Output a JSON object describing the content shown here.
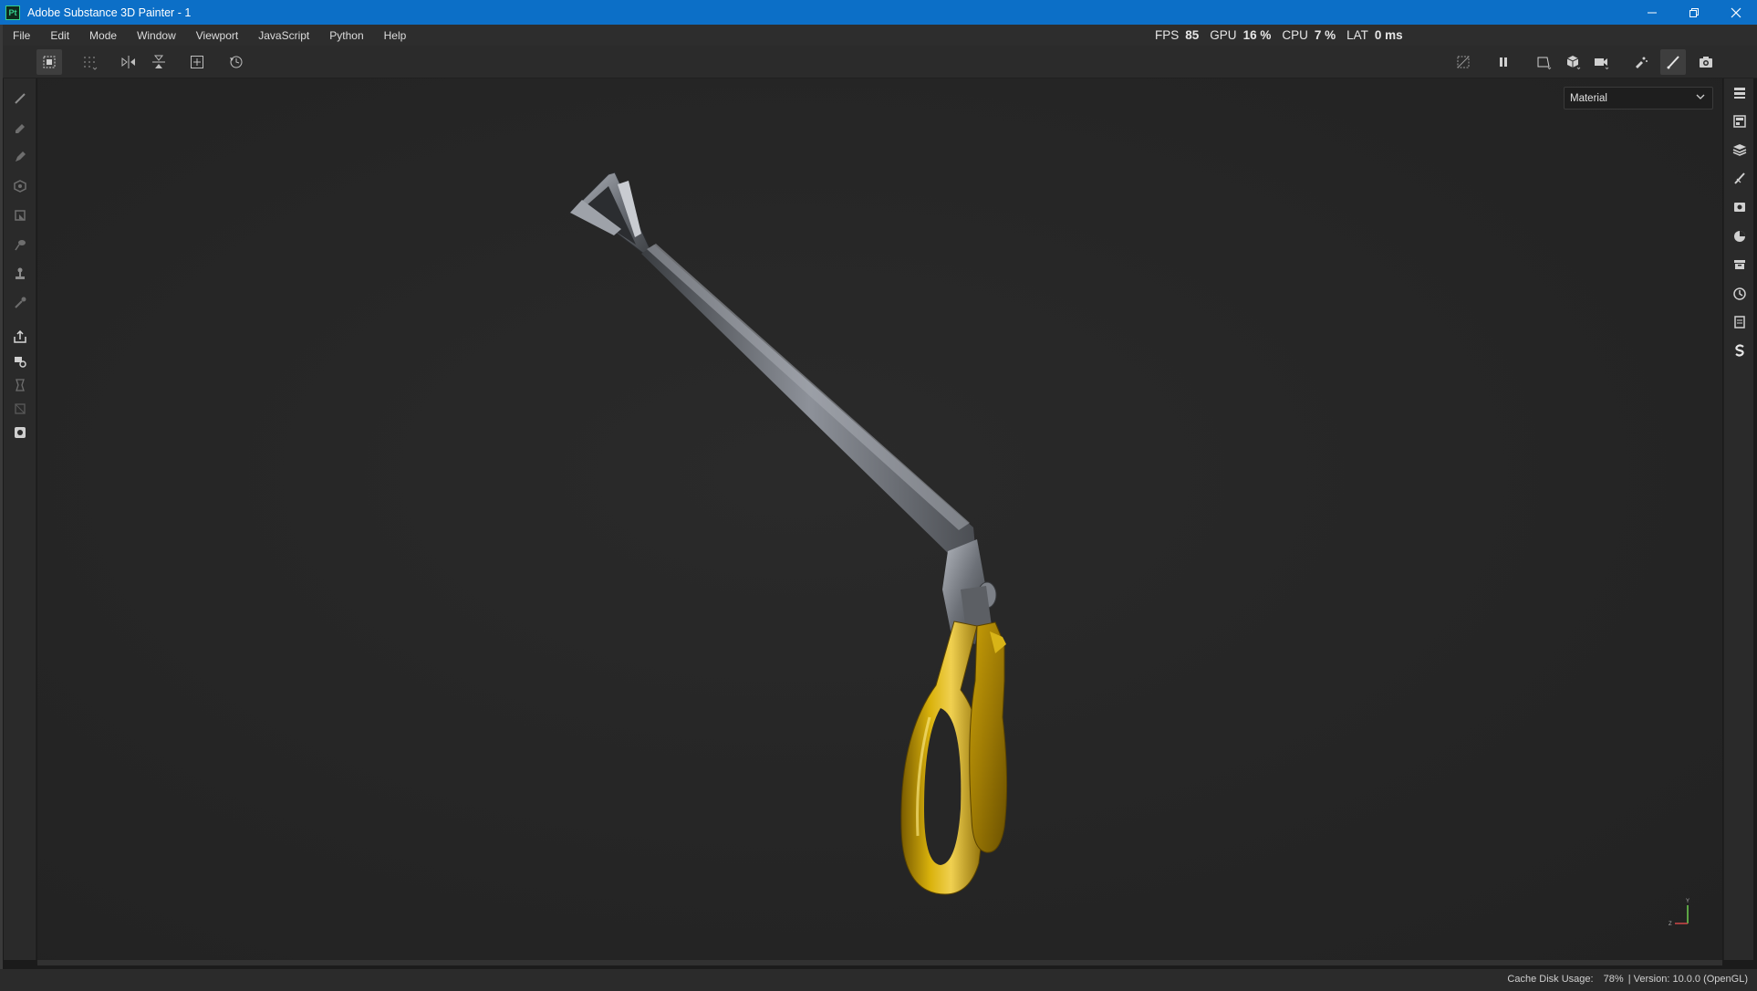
{
  "window": {
    "title": "Adobe Substance 3D Painter - 1",
    "app_icon_text": "Pt",
    "controls": [
      "minimize-icon",
      "restore-icon",
      "close-icon"
    ]
  },
  "menu": {
    "items": [
      "File",
      "Edit",
      "Mode",
      "Window",
      "Viewport",
      "JavaScript",
      "Python",
      "Help"
    ]
  },
  "stats": {
    "fps_label": "FPS",
    "fps_value": "85",
    "gpu_label": "GPU",
    "gpu_value": "16 %",
    "cpu_label": "CPU",
    "cpu_value": "7 %",
    "lat_label": "LAT",
    "lat_value": "0 ms"
  },
  "toolbar": {
    "left_icons": [
      "select-icon",
      "grid-dots-icon",
      "symmetry-x-icon",
      "symmetry-y-icon",
      "add-frame-icon",
      "reset-icon"
    ],
    "right_icons": [
      "hide-icon",
      "pause-icon",
      "view-2d-icon",
      "view-3d-icon",
      "camera-icon",
      "effects-icon",
      "paint-brush-icon",
      "screenshot-icon"
    ]
  },
  "left_tools": [
    "paint-icon",
    "eraser-icon",
    "projection-icon",
    "polygon-fill-icon",
    "geometry-mask-icon",
    "smudge-icon",
    "clone-icon",
    "color-picker-icon",
    "bake-icon",
    "export-icon",
    "bucket-icon",
    "uv-icon",
    "render-icon"
  ],
  "right_panels": [
    "texture-set-list-icon",
    "texture-set-settings-icon",
    "layers-icon",
    "properties-icon",
    "display-settings-icon",
    "shader-settings-icon",
    "assets-icon",
    "history-icon",
    "log-icon",
    "substance-icon"
  ],
  "viewport": {
    "channel_select": "Material",
    "axis_labels": [
      "Y",
      "Z"
    ]
  },
  "status": {
    "cache_label": "Cache Disk Usage:",
    "cache_value": "78%",
    "version": "| Version: 10.0.0 (OpenGL)"
  },
  "colors": {
    "titlebar": "#0c6fc7",
    "gold": "#c9a10a",
    "steel": "#8a8d93",
    "background": "#262626"
  }
}
